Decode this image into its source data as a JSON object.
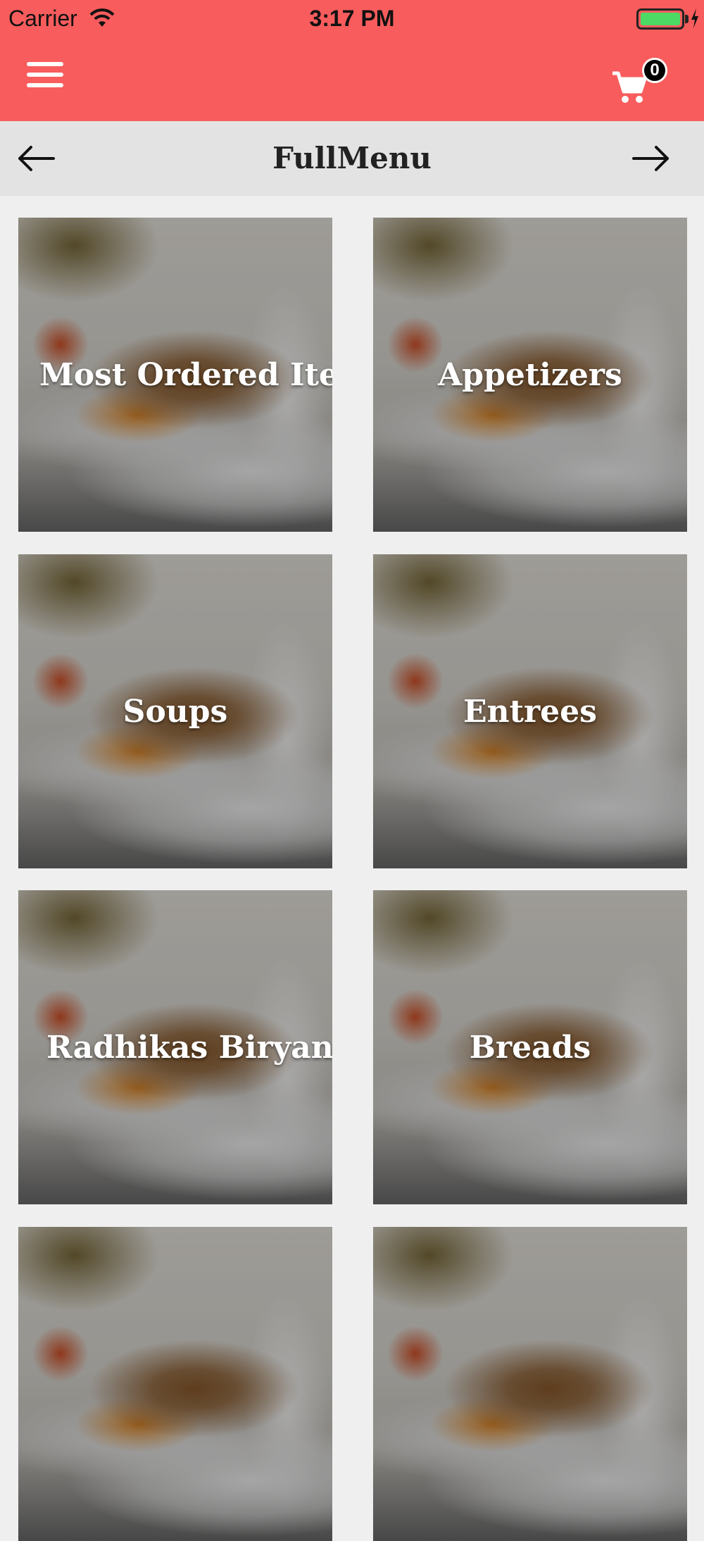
{
  "status_bar": {
    "carrier": "Carrier",
    "time": "3:17 PM",
    "battery_color": "#4cd964"
  },
  "header": {
    "background": "#f85c5c",
    "menu_icon": "hamburger-menu-icon",
    "cart_icon": "shopping-cart-icon",
    "cart_count": "0"
  },
  "sub_header": {
    "title": "FullMenu",
    "back_icon": "arrow-left-icon",
    "forward_icon": "arrow-right-icon"
  },
  "categories": [
    {
      "label": "Most Ordered Ite..."
    },
    {
      "label": "Appetizers"
    },
    {
      "label": "Soups"
    },
    {
      "label": "Entrees"
    },
    {
      "label": "Radhikas Biryanis"
    },
    {
      "label": "Breads"
    },
    {
      "label": ""
    },
    {
      "label": ""
    }
  ]
}
